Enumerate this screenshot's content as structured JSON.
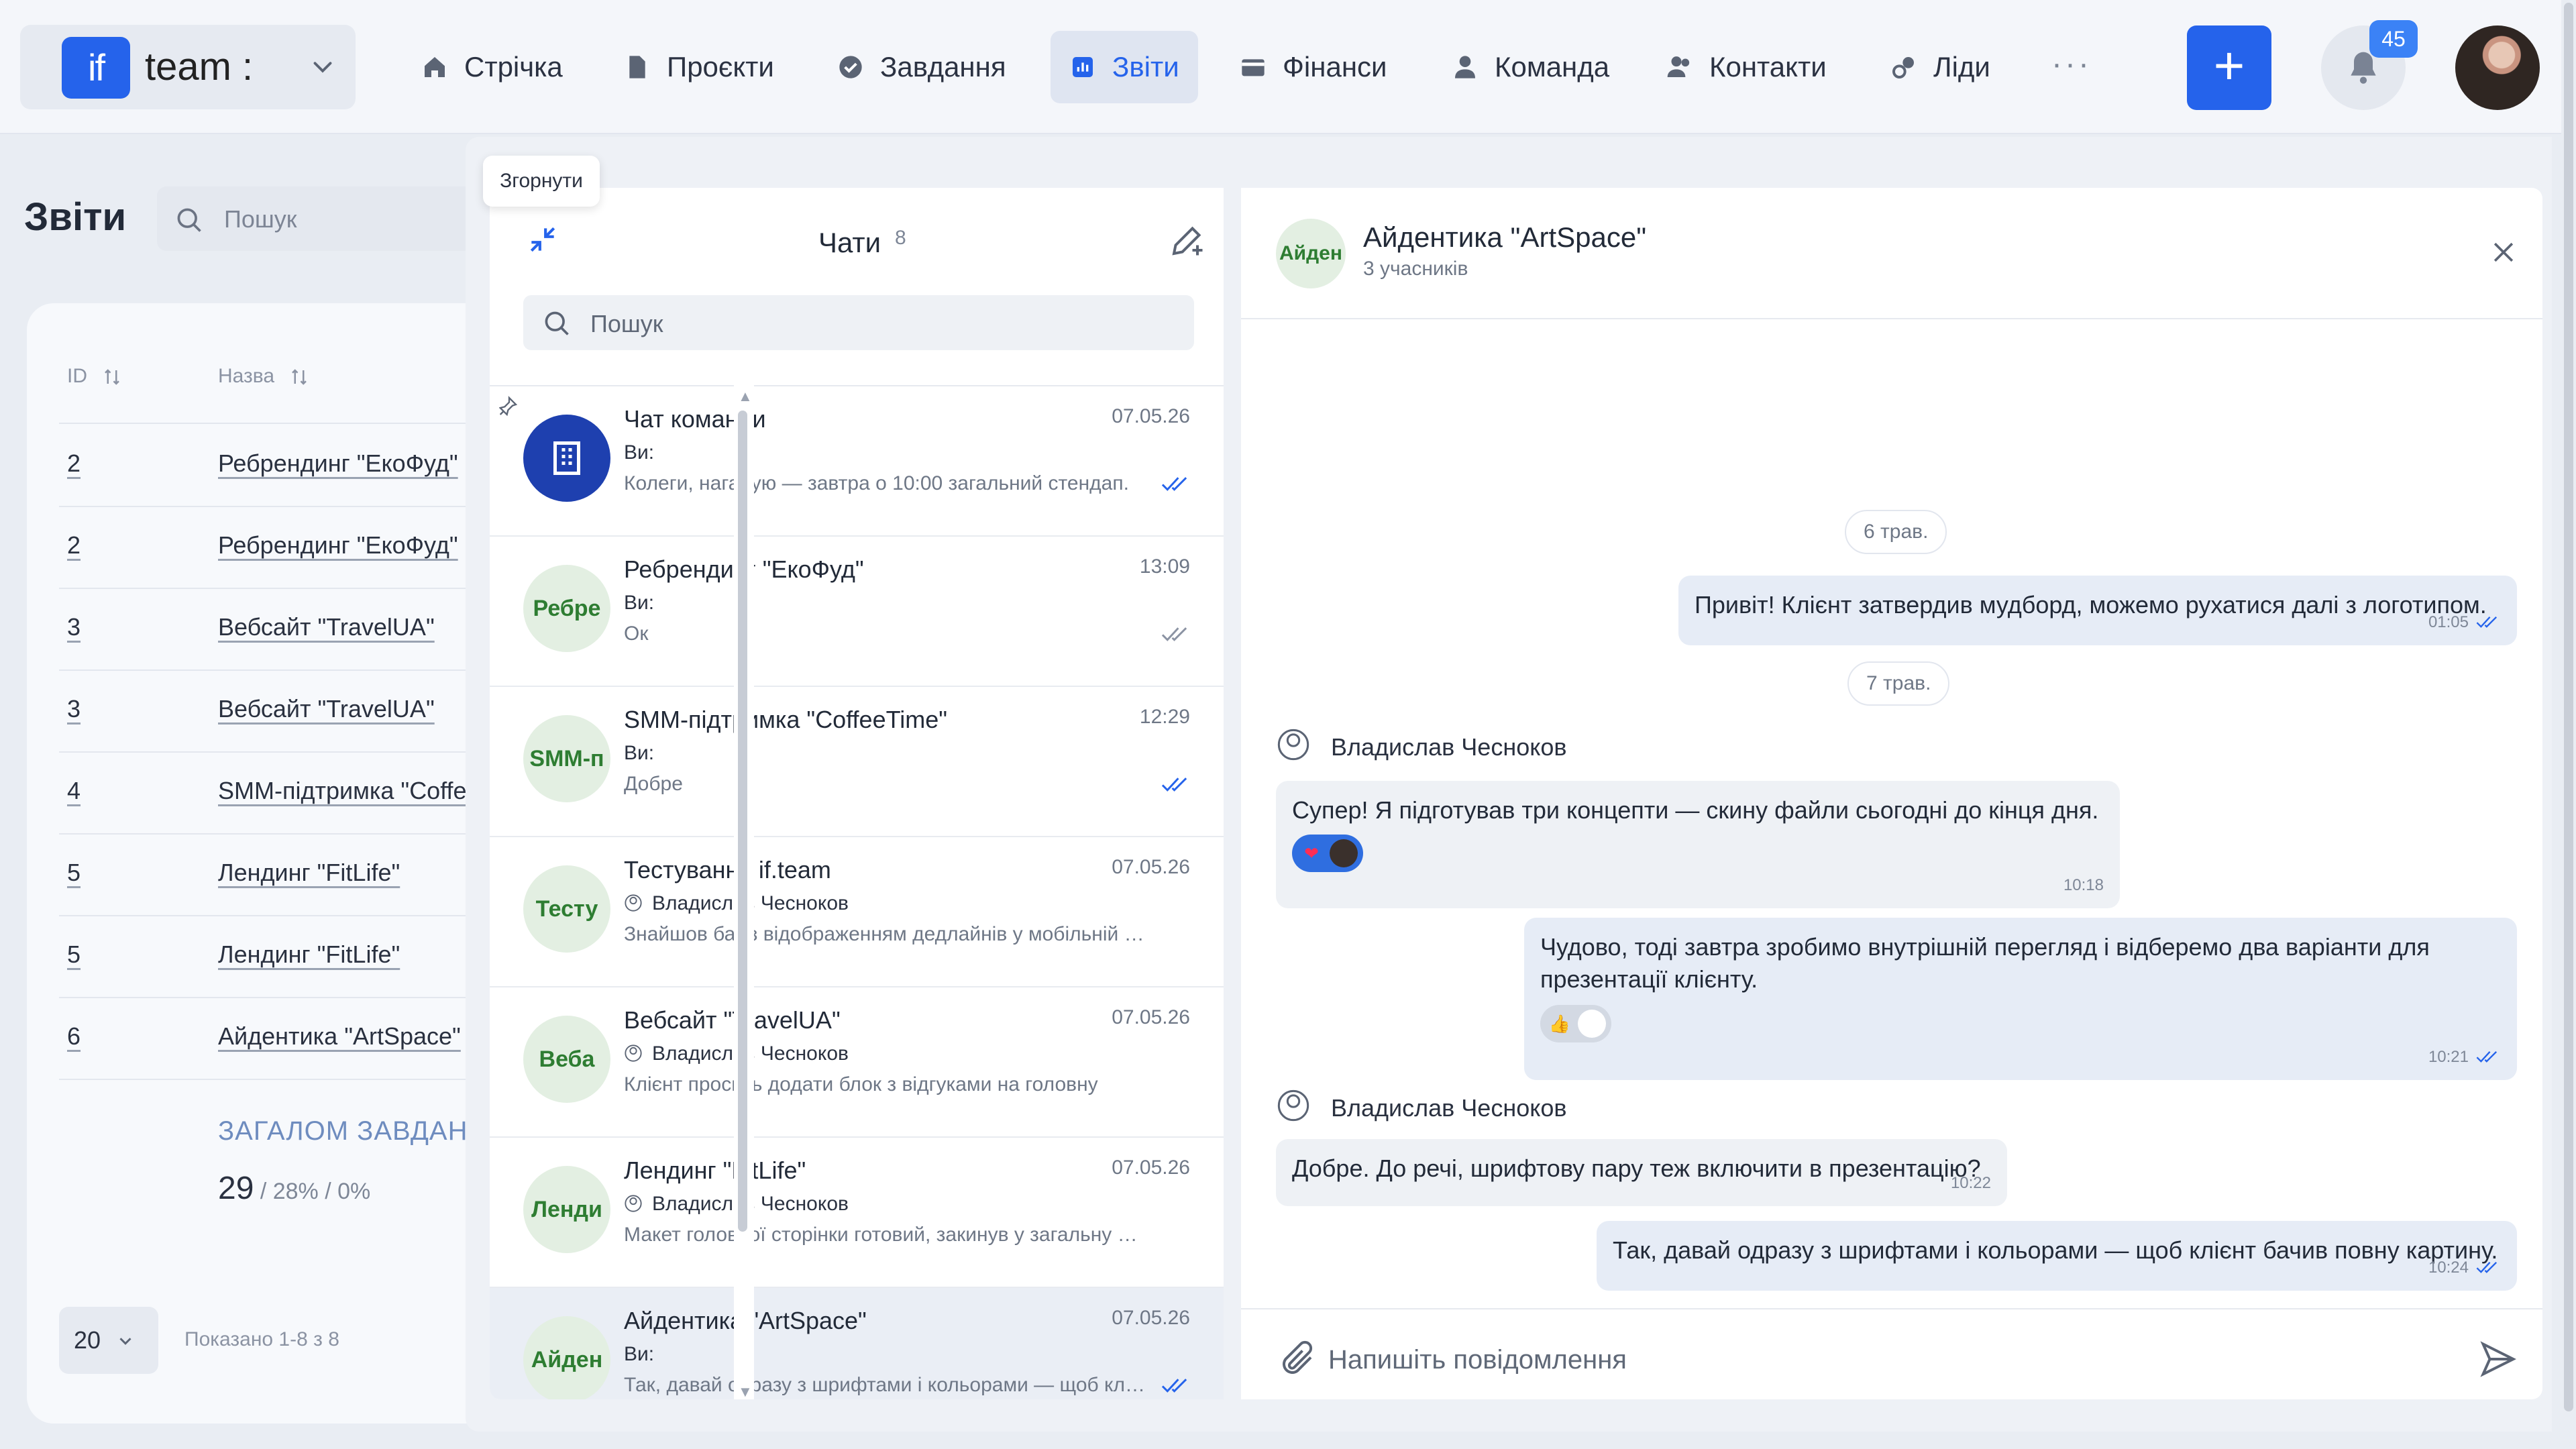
{
  "brand": {
    "logo": "if",
    "name": "team :"
  },
  "nav": [
    {
      "label": "Стрічка",
      "icon": "home-icon"
    },
    {
      "label": "Проєкти",
      "icon": "document-icon"
    },
    {
      "label": "Завдання",
      "icon": "check-circle-icon"
    },
    {
      "label": "Звіти",
      "icon": "report-icon",
      "active": true
    },
    {
      "label": "Фінанси",
      "icon": "wallet-icon"
    },
    {
      "label": "Команда",
      "icon": "user-icon"
    },
    {
      "label": "Контакти",
      "icon": "contacts-icon"
    },
    {
      "label": "Ліди",
      "icon": "leads-icon"
    }
  ],
  "header": {
    "more": "···",
    "add": "+",
    "notifications": "45"
  },
  "reports": {
    "title": "Звіти",
    "search_placeholder": "Пошук",
    "columns": {
      "id": "ID",
      "name": "Назва"
    },
    "rows": [
      {
        "id": "2",
        "name": "Ребрендинг \"ЕкоФуд\""
      },
      {
        "id": "2",
        "name": "Ребрендинг \"ЕкоФуд\""
      },
      {
        "id": "3",
        "name": "Вебсайт \"TravelUA\""
      },
      {
        "id": "3",
        "name": "Вебсайт \"TravelUA\""
      },
      {
        "id": "4",
        "name": "SMM-підтримка \"CoffeeT"
      },
      {
        "id": "5",
        "name": "Лендинг \"FitLife\""
      },
      {
        "id": "5",
        "name": "Лендинг \"FitLife\""
      },
      {
        "id": "6",
        "name": "Айдентика \"ArtSpace\""
      }
    ],
    "total_label": "ЗАГАЛОМ ЗАВДАНЬ",
    "total_value": "29",
    "total_pct": " / 28% / 0%",
    "per_page": "20",
    "shown": "Показано 1-8 з 8"
  },
  "chat_list": {
    "tooltip": "Згорнути",
    "title": "Чати",
    "count": "8",
    "search_placeholder": "Пошук",
    "items": [
      {
        "avatar": "",
        "title": "Чат команди",
        "sender": "Ви:",
        "preview": "Колеги, нагадую — завтра о 10:00 загальний стендап.",
        "date": "07.05.26",
        "read": true
      },
      {
        "avatar": "Ребре",
        "title": "Ребрендинг \"ЕкоФуд\"",
        "sender": "Ви:",
        "preview": "Ок",
        "date": "13:09",
        "read": true
      },
      {
        "avatar": "SMM-п",
        "title": "SMM-підтримка \"CoffeeTime\"",
        "sender": "Ви:",
        "preview": "Добре",
        "date": "12:29",
        "read": true
      },
      {
        "avatar": "Тесту",
        "title": "Тестування if.team",
        "sender": "Владислав Чесноков",
        "preview": "Знайшов баг з відображенням дедлайнів у мобільній версії",
        "date": "07.05.26"
      },
      {
        "avatar": "Веба",
        "title": "Вебсайт \"TravelUA\"",
        "sender": "Владислав Чесноков",
        "preview": "Клієнт просить додати блок з відгуками на головну",
        "date": "07.05.26"
      },
      {
        "avatar": "Ленди",
        "title": "Лендинг \"FitLife\"",
        "sender": "Владислав Чесноков",
        "preview": "Макет головної сторінки готовий, закинув у загальну папку",
        "date": "07.05.26"
      },
      {
        "avatar": "Айден",
        "title": "Айдентика \"ArtSpace\"",
        "sender": "Ви:",
        "preview": "Так, давай одразу з шрифтами і кольорами — щоб клієнт бачив",
        "date": "07.05.26",
        "read": true,
        "selected": true
      }
    ]
  },
  "conversation": {
    "avatar": "Айден",
    "title": "Айдентика \"ArtSpace\"",
    "subtitle": "3 учасників",
    "input_placeholder": "Напишіть повідомлення",
    "date1": "6 трав.",
    "date2": "7 трав.",
    "sender": "Владислав Чесноков",
    "messages": [
      {
        "text": "Привіт! Клієнт затвердив мудборд, можемо рухатися далі з логотипом.",
        "time": "01:05"
      },
      {
        "text": "Супер! Я підготував три концепти — скину файли сьогодні до кінця дня.",
        "time": "10:18",
        "reaction": "❤"
      },
      {
        "text": "Чудово, тоді завтра зробимо внутрішній перегляд і відберемо два варіанти для презентації клієнту.",
        "time": "10:21",
        "reaction": "👍"
      },
      {
        "text": "Добре. До речі, шрифтову пару теж включити в презентацію?",
        "time": "10:22"
      },
      {
        "text": "Так, давай одразу з шрифтами і кольорами — щоб клієнт бачив повну картину.",
        "time": "10:24"
      }
    ]
  },
  "colors": {
    "accent": "#2563eb",
    "badge": "#3b82f6",
    "avatar_green": "#2e7d32"
  }
}
